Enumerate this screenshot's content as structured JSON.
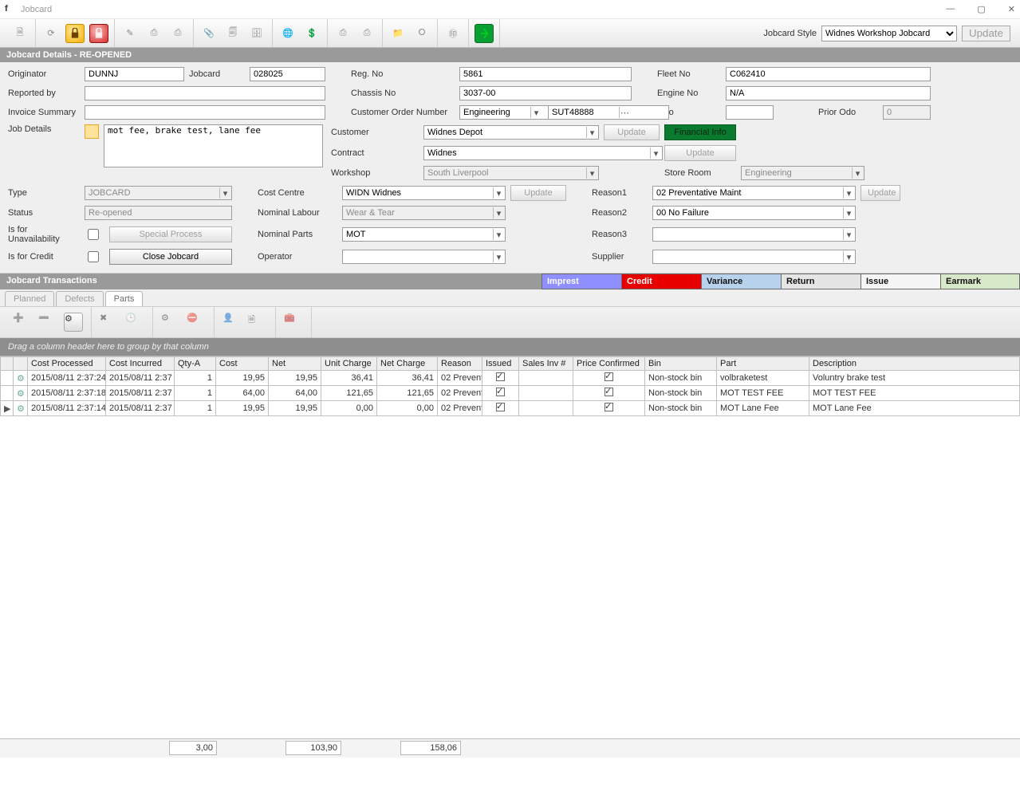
{
  "window": {
    "title": "Jobcard"
  },
  "toolbar": {
    "jobcard_style_label": "Jobcard Style",
    "jobcard_style_value": "Widnes Workshop Jobcard",
    "update_label": "Update"
  },
  "section_details_title": "Jobcard Details - RE-OPENED",
  "labels": {
    "originator": "Originator",
    "jobcard": "Jobcard",
    "reg_no": "Reg. No",
    "fleet_no": "Fleet No",
    "reported_by": "Reported by",
    "chassis_no": "Chassis No",
    "engine_no": "Engine No",
    "invoice_summary": "Invoice Summary",
    "cust_order_no": "Customer Order Number",
    "odo": "Odo",
    "prior_odo": "Prior Odo",
    "job_details": "Job Details",
    "customer": "Customer",
    "contract": "Contract",
    "workshop": "Workshop",
    "store_room": "Store Room",
    "type": "Type",
    "cost_centre": "Cost Centre",
    "reason1": "Reason1",
    "status": "Status",
    "nominal_labour": "Nominal Labour",
    "reason2": "Reason2",
    "is_for_unavailability": "Is for Unavailability",
    "special_process": "Special Process",
    "nominal_parts": "Nominal Parts",
    "reason3": "Reason3",
    "is_for_credit": "Is for Credit",
    "close_jobcard": "Close Jobcard",
    "operator": "Operator",
    "supplier": "Supplier",
    "update": "Update",
    "financial_info": "Financial Info"
  },
  "form": {
    "originator": "DUNNJ",
    "jobcard": "028025",
    "reg_no": "5861",
    "fleet_no": "C062410",
    "reported_by": "",
    "chassis_no": "3037-00",
    "engine_no": "N/A",
    "invoice_summary": "",
    "cust_order_type": "Engineering",
    "cust_order_no": "SUT48888",
    "odo": "",
    "prior_odo": "0",
    "job_details": "mot fee, brake test, lane fee",
    "customer": "Widnes Depot",
    "contract": "Widnes",
    "workshop": "South Liverpool",
    "store_room": "Engineering",
    "type": "JOBCARD",
    "cost_centre": "WIDN Widnes",
    "reason1": "02 Preventative Maint",
    "status": "Re-opened",
    "nominal_labour": "Wear & Tear",
    "reason2": "00 No Failure",
    "nominal_parts": "MOT",
    "reason3": "",
    "operator": "",
    "supplier": ""
  },
  "transactions": {
    "title": "Jobcard Transactions",
    "legend": {
      "imprest": "Imprest",
      "credit": "Credit",
      "variance": "Variance",
      "return": "Return",
      "issue": "Issue",
      "earmark": "Earmark"
    },
    "tabs": {
      "planned": "Planned",
      "defects": "Defects",
      "parts": "Parts"
    },
    "group_hint": "Drag a column header here to group by that column",
    "columns": [
      "Cost Processed",
      "Cost Incurred",
      "Qty-A",
      "Cost",
      "Net",
      "Unit Charge",
      "Net Charge",
      "Reason",
      "Issued",
      "Sales Inv #",
      "Price Confirmed",
      "Bin",
      "Part",
      "Description"
    ],
    "rows": [
      {
        "sel": "",
        "cost_processed": "2015/08/11 2:37:24",
        "cost_incurred": "2015/08/11 2:37",
        "qty": "1",
        "cost": "19,95",
        "net": "19,95",
        "unit_charge": "36,41",
        "net_charge": "36,41",
        "reason": "02 Prevent",
        "issued": true,
        "sales_inv": "",
        "price_confirmed": true,
        "bin": "Non-stock bin",
        "part": "volbraketest",
        "description": "Voluntry brake test"
      },
      {
        "sel": "",
        "cost_processed": "2015/08/11 2:37:18",
        "cost_incurred": "2015/08/11 2:37",
        "qty": "1",
        "cost": "64,00",
        "net": "64,00",
        "unit_charge": "121,65",
        "net_charge": "121,65",
        "reason": "02 Prevent",
        "issued": true,
        "sales_inv": "",
        "price_confirmed": true,
        "bin": "Non-stock bin",
        "part": "MOT TEST FEE",
        "description": "MOT TEST FEE"
      },
      {
        "sel": "▶",
        "cost_processed": "2015/08/11 2:37:14",
        "cost_incurred": "2015/08/11 2:37",
        "qty": "1",
        "cost": "19,95",
        "net": "19,95",
        "unit_charge": "0,00",
        "net_charge": "0,00",
        "reason": "02 Prevent",
        "issued": true,
        "sales_inv": "",
        "price_confirmed": true,
        "bin": "Non-stock bin",
        "part": "MOT Lane Fee",
        "description": "MOT Lane Fee"
      }
    ],
    "footer": {
      "qty": "3,00",
      "net": "103,90",
      "net_charge": "158,06"
    }
  }
}
